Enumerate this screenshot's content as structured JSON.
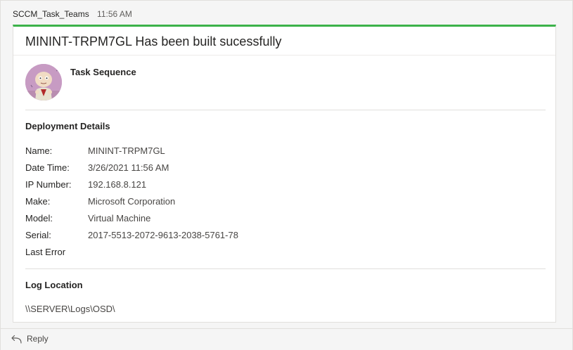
{
  "message": {
    "sender": "SCCM_Task_Teams",
    "time": "11:56 AM"
  },
  "card": {
    "accent_color": "#3cb24a",
    "title": "MININT-TRPM7GL Has been built sucessfully",
    "task_label": "Task Sequence",
    "deployment_section_title": "Deployment Details",
    "facts": [
      {
        "key": "Name:",
        "value": "MININT-TRPM7GL"
      },
      {
        "key": "Date Time:",
        "value": "3/26/2021 11:56 AM"
      },
      {
        "key": "IP Number:",
        "value": "192.168.8.121"
      },
      {
        "key": "Make:",
        "value": "Microsoft Corporation"
      },
      {
        "key": "Model:",
        "value": "Virtual Machine"
      },
      {
        "key": "Serial:",
        "value": "2017-5513-2072-9613-2038-5761-78"
      },
      {
        "key": "Last Error",
        "value": ""
      }
    ],
    "log_section_title": "Log Location",
    "log_path": "\\\\SERVER\\Logs\\OSD\\"
  },
  "reply": {
    "label": "Reply",
    "icon": "reply-arrow-icon"
  }
}
